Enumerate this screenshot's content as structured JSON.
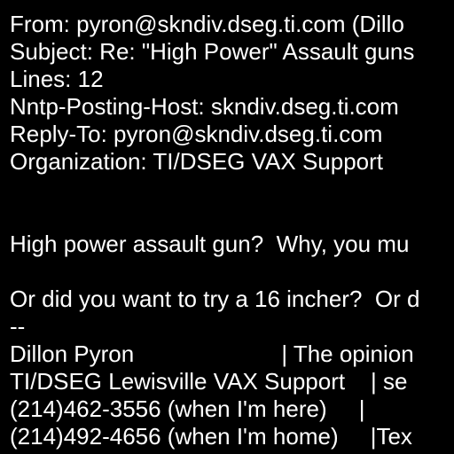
{
  "colors": {
    "background": "#000000",
    "text": "#ffffff"
  },
  "headers": {
    "from": "From: pyron@skndiv.dseg.ti.com (Dillo",
    "subject": "Subject: Re: \"High Power\" Assault guns",
    "lines": "Lines: 12",
    "nntp_posting_host": "Nntp-Posting-Host: skndiv.dseg.ti.com",
    "reply_to": "Reply-To: pyron@skndiv.dseg.ti.com",
    "organization": "Organization: TI/DSEG VAX Support"
  },
  "body": {
    "line1": "High power assault gun?  Why, you mu",
    "line2": "Or did you want to try a 16 incher?  Or d"
  },
  "signature": {
    "separator": "--",
    "line1": "Dillon Pyron                       | The opinion",
    "line2": "TI/DSEG Lewisville VAX Support    | se",
    "line3": "(214)462-3556 (when I'm here)     |",
    "line4": "(214)492-4656 (when I'm home)     |Tex"
  }
}
